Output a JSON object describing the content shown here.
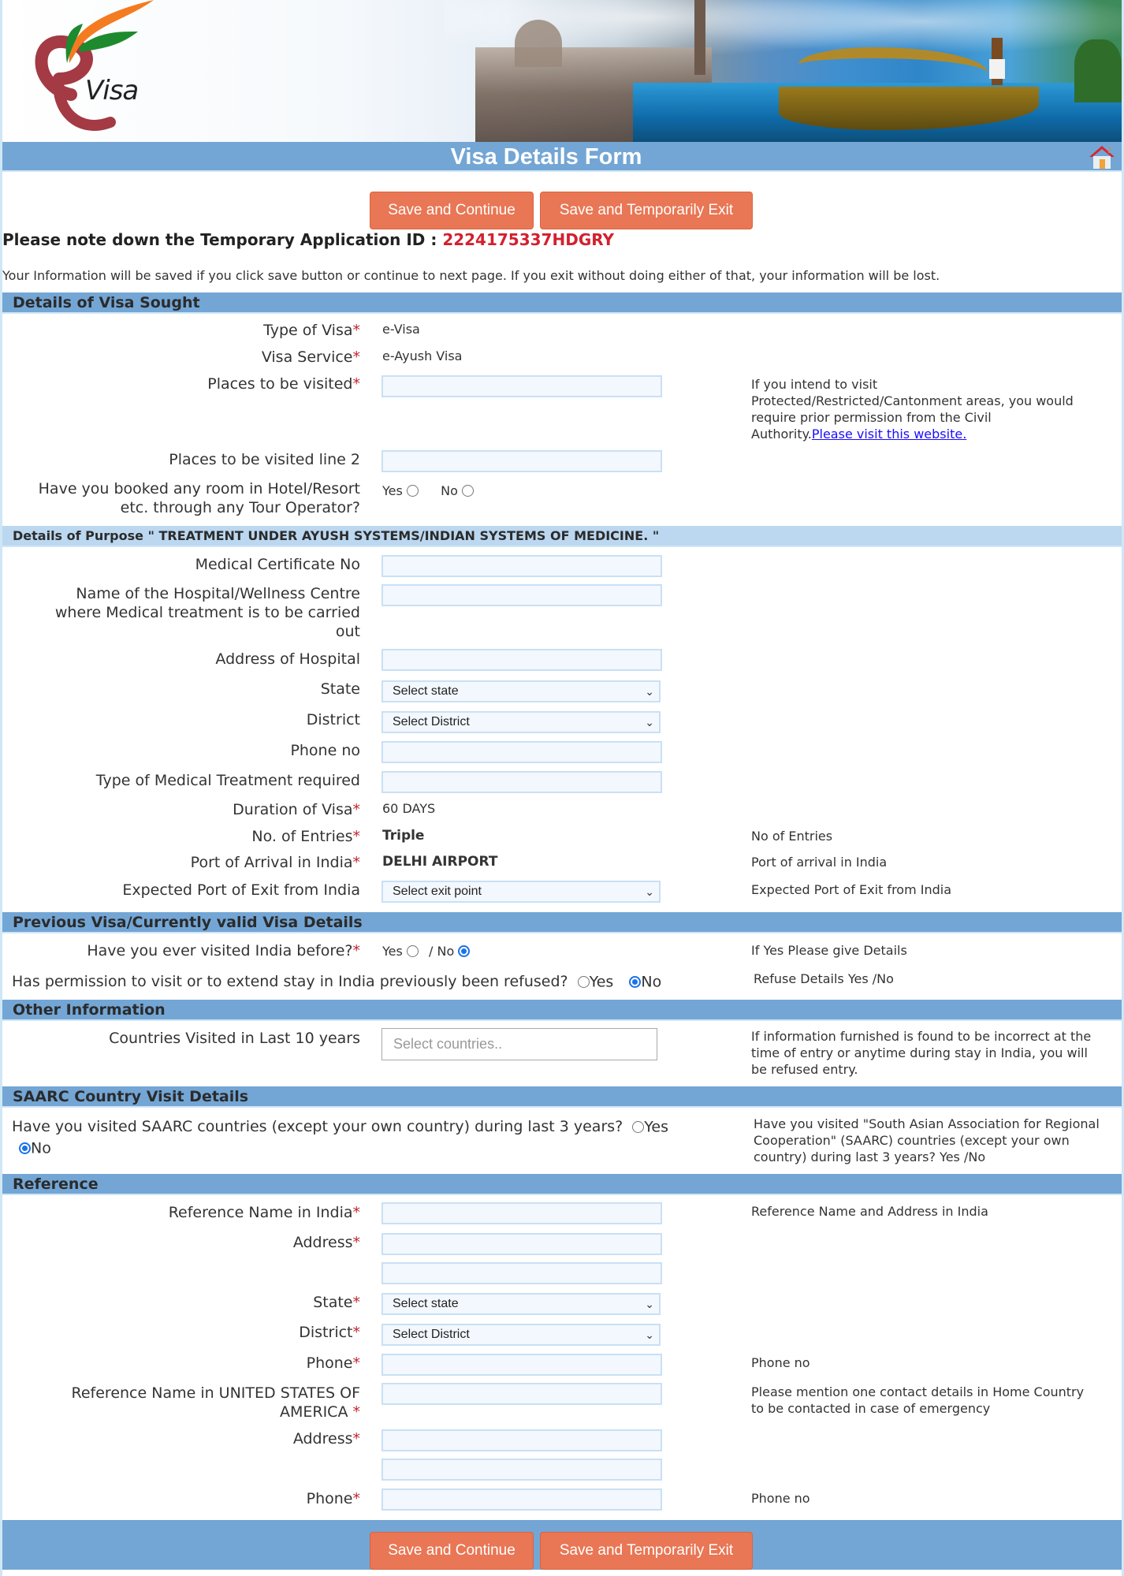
{
  "header": {
    "logo_text": "Visa",
    "title": "Visa Details Form",
    "home_icon": "home-icon"
  },
  "actions": {
    "save_continue": "Save and Continue",
    "save_exit": "Save and Temporarily Exit"
  },
  "application": {
    "id_label": "Please note down the Temporary Application ID : ",
    "id_value": "2224175337HDGRY",
    "info_text": "Your Information will be saved if you click save button or continue to next page. If you exit without doing either of that, your information will be lost."
  },
  "visa_sought": {
    "heading": "Details of Visa Sought",
    "type_label": "Type of Visa",
    "type_value": "e-Visa",
    "service_label": "Visa Service",
    "service_value": "e-Ayush Visa",
    "places_label": "Places to be visited",
    "places_value": "",
    "places_hint": "If you intend to visit Protected/Restricted/Cantonment areas, you would require prior permission from the Civil Authority.",
    "places_hint_link": "Please visit this website.",
    "places2_label": "Places to be visited line 2",
    "places2_value": "",
    "booked_label": "Have you booked any room in Hotel/Resort etc. through any Tour Operator?",
    "booked_yes": "Yes",
    "booked_no": "No",
    "booked_selected": null
  },
  "purpose": {
    "heading": "Details of Purpose \" TREATMENT UNDER AYUSH SYSTEMS/INDIAN SYSTEMS OF MEDICINE. \"",
    "cert_label": "Medical Certificate No",
    "hospital_label": "Name of the Hospital/Wellness Centre where Medical treatment is to be carried out",
    "address_label": "Address of Hospital",
    "state_label": "State",
    "state_value": "Select state",
    "district_label": "District",
    "district_value": "Select District",
    "phone_label": "Phone no",
    "treatment_label": "Type of Medical Treatment required",
    "duration_label": "Duration of Visa",
    "duration_value": "60 DAYS",
    "entries_label": "No. of Entries",
    "entries_value": "Triple",
    "entries_hint": "No of Entries",
    "arrival_label": "Port of Arrival in India",
    "arrival_value": "DELHI AIRPORT",
    "arrival_hint": "Port of arrival in India",
    "exit_label": "Expected Port of Exit from India",
    "exit_value": "Select exit point",
    "exit_hint": "Expected Port of Exit from India"
  },
  "previous_visa": {
    "heading": "Previous Visa/Currently valid Visa Details",
    "visited_label": "Have you ever visited India before?",
    "visited_yes": "Yes",
    "visited_sep": "/ No",
    "visited_selected": "No",
    "visited_hint": "If Yes Please give Details",
    "refused_label": "Has permission to visit or to extend stay in India previously been refused?",
    "refused_yes": "Yes",
    "refused_no": "No",
    "refused_selected": "No",
    "refused_hint": "Refuse Details Yes /No"
  },
  "other_info": {
    "heading": "Other Information",
    "countries_label": "Countries Visited in Last 10 years",
    "countries_placeholder": "Select countries..",
    "countries_hint": "If information furnished is found to be incorrect at the time of entry or anytime during stay in India, you will be refused entry."
  },
  "saarc": {
    "heading": "SAARC Country Visit Details",
    "question": "Have you visited SAARC countries (except your own country) during last 3 years?",
    "yes": "Yes",
    "no": "No",
    "selected": "No",
    "hint": "Have you visited \"South Asian Association for Regional Cooperation\" (SAARC) countries (except your own country) during last 3 years? Yes /No"
  },
  "reference": {
    "heading": "Reference",
    "india_name_label": "Reference Name in India",
    "india_name_hint": "Reference Name and Address in India",
    "india_address_label": "Address",
    "india_state_label": "State",
    "india_state_value": "Select state",
    "india_district_label": "District",
    "india_district_value": "Select District",
    "india_phone_label": "Phone",
    "india_phone_hint": "Phone no",
    "home_name_label": "Reference Name in UNITED STATES OF AMERICA",
    "home_name_hint": "Please mention one contact details in Home Country to be contacted in case of emergency",
    "home_address_label": "Address",
    "home_phone_label": "Phone",
    "home_phone_hint": "Phone no"
  },
  "required_marker": "*",
  "colors": {
    "accent_blue": "#73a6d5",
    "button_orange": "#e97654",
    "id_red": "#d3202e",
    "required_red": "#c0262d"
  }
}
